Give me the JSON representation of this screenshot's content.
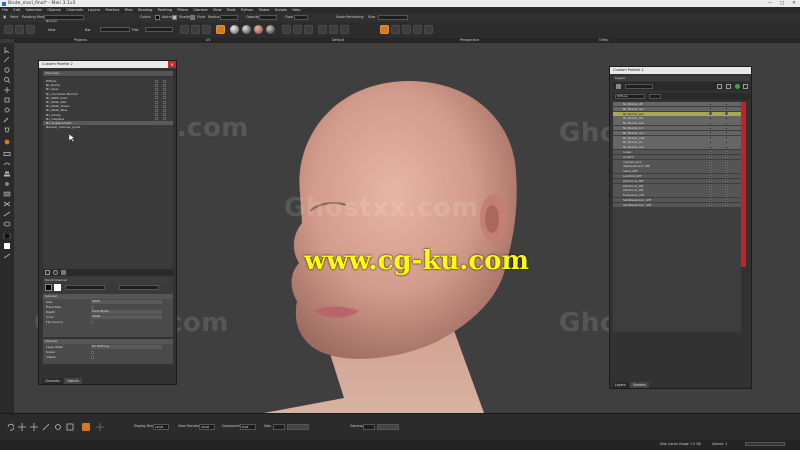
{
  "window": {
    "title": "Brute_mari_final* - Mari 3.1v3",
    "minimize": "—",
    "maximize": "□",
    "close": "✕"
  },
  "menu": [
    "File",
    "Edit",
    "Selection",
    "Objects",
    "Channels",
    "Layers",
    "Patches",
    "Files",
    "Shading",
    "Painting",
    "Filters",
    "Camera",
    "View",
    "Tools",
    "Python",
    "Shake",
    "Scripts",
    "Help"
  ],
  "tool_options": {
    "paint_label": "Paint",
    "paint_mode": "Painting Mode",
    "paint_mode_value": "Normal",
    "colors_label": "Colors",
    "alpha_label": "Alpha",
    "shadow_label": "Shadow",
    "fluid_label": "Fluid",
    "radius_label": "Radius",
    "opacity_label": "Opacity",
    "flow_label": "Flow",
    "scale_label": "Scale Rendering",
    "size_label": "Size"
  },
  "tool_row2": {
    "new_label": "New",
    "bar_label": "Bar",
    "flat_label": "Flat"
  },
  "view_tabs": [
    "Projects",
    "UV",
    "Default",
    "Perspective",
    "Ortho"
  ],
  "left_panel": {
    "title": "Custom Palette 2",
    "header": "Channels",
    "rows": [
      "Diffuse",
      "Nc_Bump",
      "Nc_Spec",
      "Nc_Constrain Normal",
      "Nc_SPEC Color",
      "Nc_Mask_Red",
      "Nc_Mask_Green",
      "Nc_Mask_Blue",
      "Nc_Cavity",
      "Nc_Displace",
      "Nc_displacement",
      "Neutral_channel_guide"
    ],
    "selected_index": 10,
    "quick_channel": "Quick Channel",
    "section_general": "General",
    "general_rows": [
      {
        "label": "Size",
        "value": "4096"
      },
      {
        "label": "Fixed Size",
        "value": ""
      },
      {
        "label": "Depth",
        "value": "8-bit (Byte)"
      },
      {
        "label": "Color",
        "value": "sRGB"
      },
      {
        "label": "Flip Source",
        "value": ""
      }
    ],
    "section_channel": "Channel",
    "channel_rows": [
      {
        "label": "Layer Mask",
        "value": "Do Nothing"
      },
      {
        "label": "Scalar",
        "value": ""
      },
      {
        "label": "Visible",
        "value": ""
      }
    ],
    "tabs": [
      "Channels",
      "Objects"
    ]
  },
  "right_panel": {
    "title": "Custom Palette 1",
    "header": "Layers",
    "dropdown": "Diffuse",
    "rows": [
      "Nc_Bump_dif",
      "Nc_Bump_nor",
      "Nc_Bump_spe",
      "Nc_Bump_dis",
      "Nc_Bump_spe",
      "Nc_Bump_col",
      "Nc_Bump_rou",
      "Nc_Bump_msk",
      "Nc_Bump_ao",
      "Nc_Bump_cav",
      "noise",
      "scratch",
      "colored_skin",
      "displacement_diff",
      "veins_diff",
      "scarfold_diff",
      "skinfocus_diff",
      "skinfocus_diff",
      "skinfocus_diff",
      "blueveins_diff",
      "SkinBaseColor_diff",
      "SkinBaseColor_diff"
    ],
    "tabs": [
      "Layers",
      "Shaders"
    ]
  },
  "bottom_bar": {
    "display_device_label": "Display Device",
    "display_device_value": "sRGB",
    "view_transform_label": "View Transform",
    "view_transform_value": "sRGB",
    "component_label": "Component",
    "component_value": "RGB",
    "gain_label": "Gain",
    "gamma_label": "Gamma"
  },
  "status": {
    "cache": "Disk Cache Usage",
    "memory": "7.0 GB",
    "gpu": "Sphere: 1"
  },
  "watermarks": {
    "ghost": "Ghostxx.com",
    "center": "www.cg-ku.com"
  },
  "colors": {
    "accent": "#d37a22",
    "skin": "#d9a79a",
    "close": "#c62828",
    "redbar": "#c7202a"
  }
}
